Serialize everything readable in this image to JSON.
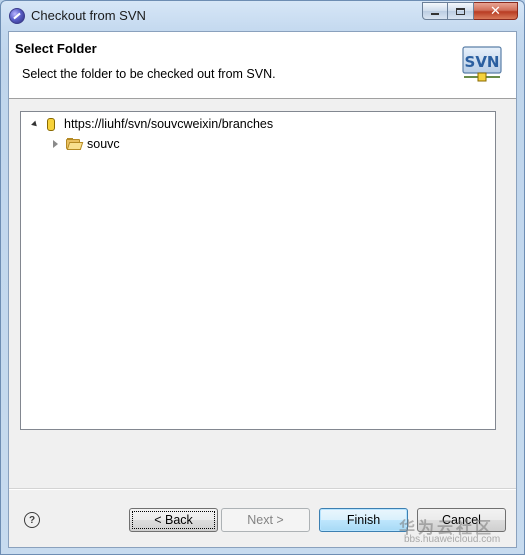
{
  "window": {
    "title": "Checkout from SVN",
    "close_glyph": "✕"
  },
  "banner": {
    "title": "Select Folder",
    "description": "Select the folder to be checked out from SVN.",
    "logo_text": "SVN"
  },
  "tree": {
    "root": {
      "label": "https://liuhf/svn/souvcweixin/branches",
      "expanded": true,
      "icon": "repository-icon"
    },
    "children": [
      {
        "label": "souvc",
        "expanded": false,
        "icon": "folder-icon"
      }
    ]
  },
  "footer": {
    "help_glyph": "?",
    "buttons": {
      "back": {
        "label": "< Back",
        "enabled": true
      },
      "next": {
        "label": "Next >",
        "enabled": false
      },
      "finish": {
        "label": "Finish",
        "enabled": true
      },
      "cancel": {
        "label": "Cancel",
        "enabled": true
      }
    }
  },
  "watermark": {
    "text": "华为云社区",
    "url": "bbs.huaweicloud.com"
  },
  "colors": {
    "frame": "#c4d9ef",
    "client_bg": "#f0f0f0",
    "close_button": "#c7482f",
    "default_button_border": "#3c7fb1"
  }
}
